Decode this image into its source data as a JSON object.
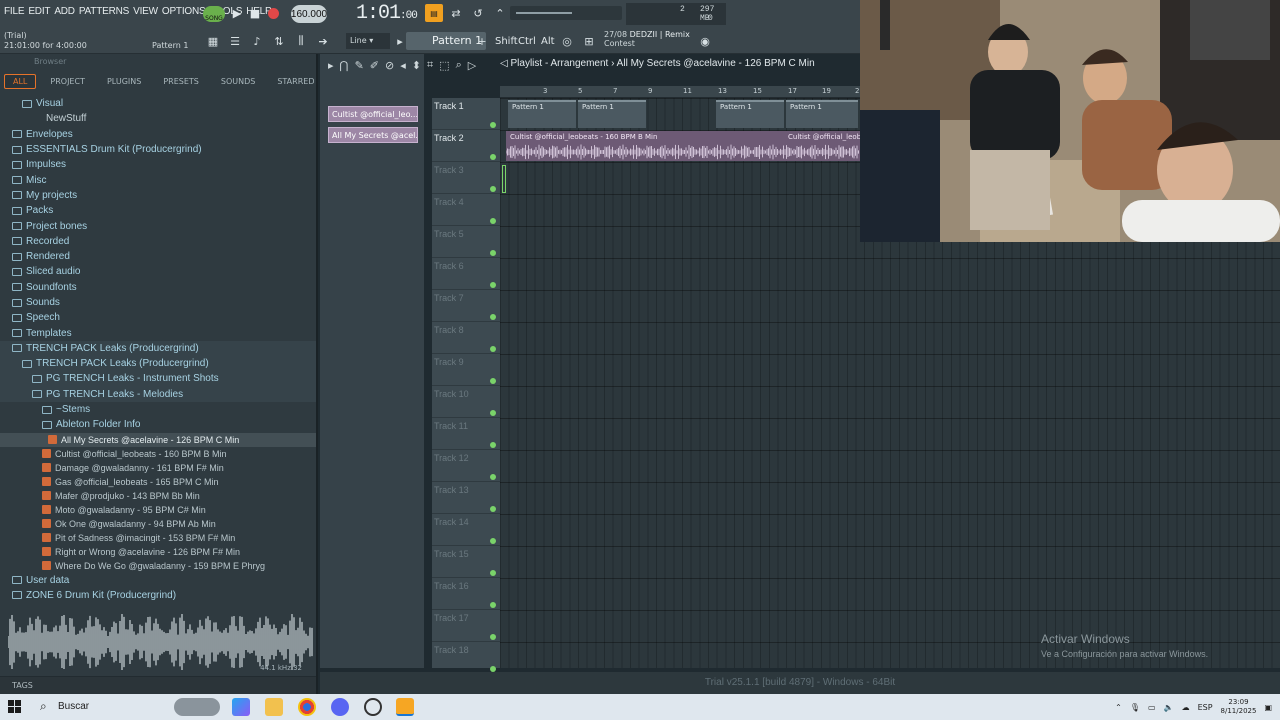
{
  "menu": [
    "FILE",
    "EDIT",
    "ADD",
    "PATTERNS",
    "VIEW",
    "OPTIONS",
    "TOOLS",
    "HELP"
  ],
  "transport": {
    "song_label": "SONG",
    "bpm": "160.000",
    "time_main": "1:01",
    "time_sub": ":00",
    "mem_label": "297 MB",
    "cpu_val": "2",
    "poly": "0"
  },
  "status_bar": {
    "trial_line1": "(Trial)",
    "trial_line2": "21:01:00 for 4:00:00",
    "pattern_label": "Pattern 1",
    "snap": "Line",
    "pattern_selector": "Pattern 1",
    "mods": [
      "Shift",
      "Ctrl",
      "Alt"
    ],
    "news_date": "27/08",
    "news_title": "DEDZII | Remix",
    "news_sub": "Contest"
  },
  "browser": {
    "header": "Browser",
    "tabs": [
      "ALL",
      "PROJECT",
      "PLUGINS",
      "PRESETS",
      "SOUNDS",
      "STARRED"
    ],
    "tree": [
      {
        "label": "Visual",
        "indent": 2,
        "kind": "folder"
      },
      {
        "label": "NewStuff",
        "indent": 3,
        "kind": "plain"
      },
      {
        "label": "Envelopes",
        "indent": 1,
        "kind": "folder"
      },
      {
        "label": "ESSENTIALS Drum Kit (Producergrind)",
        "indent": 1,
        "kind": "folder"
      },
      {
        "label": "Impulses",
        "indent": 1,
        "kind": "folder"
      },
      {
        "label": "Misc",
        "indent": 1,
        "kind": "folder"
      },
      {
        "label": "My projects",
        "indent": 1,
        "kind": "folder"
      },
      {
        "label": "Packs",
        "indent": 1,
        "kind": "folder"
      },
      {
        "label": "Project bones",
        "indent": 1,
        "kind": "folder"
      },
      {
        "label": "Recorded",
        "indent": 1,
        "kind": "folder"
      },
      {
        "label": "Rendered",
        "indent": 1,
        "kind": "folder"
      },
      {
        "label": "Sliced audio",
        "indent": 1,
        "kind": "folder"
      },
      {
        "label": "Soundfonts",
        "indent": 1,
        "kind": "folder"
      },
      {
        "label": "Sounds",
        "indent": 1,
        "kind": "folder"
      },
      {
        "label": "Speech",
        "indent": 1,
        "kind": "folder"
      },
      {
        "label": "Templates",
        "indent": 1,
        "kind": "folder"
      },
      {
        "label": "TRENCH PACK Leaks (Producergrind)",
        "indent": 1,
        "kind": "folder",
        "band": true
      },
      {
        "label": "TRENCH PACK Leaks (Producergrind)",
        "indent": 2,
        "kind": "folder",
        "band": true
      },
      {
        "label": "PG TRENCH Leaks - Instrument Shots",
        "indent": 3,
        "kind": "folder",
        "band": true
      },
      {
        "label": "PG TRENCH Leaks - Melodies",
        "indent": 3,
        "kind": "folder",
        "band": true
      },
      {
        "label": "~Stems",
        "indent": 4,
        "kind": "folder"
      },
      {
        "label": "Ableton Folder Info",
        "indent": 4,
        "kind": "folder"
      }
    ],
    "files": [
      {
        "label": "All My Secrets @acelavine - 126 BPM C Min",
        "current": true
      },
      {
        "label": "Cultist @official_leobeats - 160 BPM B Min"
      },
      {
        "label": "Damage @gwaladanny - 161 BPM F# Min"
      },
      {
        "label": "Gas @official_leobeats - 165 BPM C Min"
      },
      {
        "label": "Mafer @prodjuko - 143 BPM Bb Min"
      },
      {
        "label": "Moto @gwaladanny - 95 BPM C# Min"
      },
      {
        "label": "Ok One @gwaladanny - 94 BPM Ab Min"
      },
      {
        "label": "Pit of Sadness @imacingit - 153 BPM F# Min"
      },
      {
        "label": "Right or Wrong @acelavine - 126 BPM F# Min"
      },
      {
        "label": "Where Do We Go @gwaladanny - 159 BPM E Phryg"
      }
    ],
    "tail": [
      {
        "label": "User data",
        "indent": 1
      },
      {
        "label": "ZONE 6 Drum Kit (Producergrind)",
        "indent": 1
      }
    ],
    "sample_info": "44.1 kHz 32",
    "tags_label": "TAGS"
  },
  "playlist": {
    "title": "Playlist - Arrangement",
    "arrow": "›",
    "song": "All My Secrets @acelavine - 126 BPM C Min",
    "clips_left": [
      "Cultist @official_leo...",
      "All My Secrets @acel..."
    ],
    "ruler_ticks": [
      "3",
      "5",
      "7",
      "9",
      "11",
      "13",
      "15",
      "17",
      "19",
      "2"
    ],
    "pattern_clips": [
      "Pattern 1",
      "Pattern 1",
      "Pattern 1",
      "Pattern 1"
    ],
    "audio_clip_label": "Cultist @official_leobeats - 160 BPM B Min",
    "audio_clip_label2": "Cultist @official_leobe",
    "tracks": [
      "Track 1",
      "Track 2",
      "Track 3",
      "Track 4",
      "Track 5",
      "Track 6",
      "Track 7",
      "Track 8",
      "Track 9",
      "Track 10",
      "Track 11",
      "Track 12",
      "Track 13",
      "Track 14",
      "Track 15",
      "Track 16",
      "Track 17",
      "Track 18"
    ]
  },
  "footer": {
    "version": "Trial v25.1.1 [build 4879] - Windows - 64Bit",
    "activate_title": "Activar Windows",
    "activate_sub": "Ve a Configuración para activar Windows."
  },
  "taskbar": {
    "search": "Buscar",
    "lang": "ESP",
    "time": "23:09",
    "date": "8/11/2025"
  },
  "colors": {
    "accent": "#e6732a",
    "clip": "#9d87a6",
    "song_button": "#6ab04c"
  }
}
